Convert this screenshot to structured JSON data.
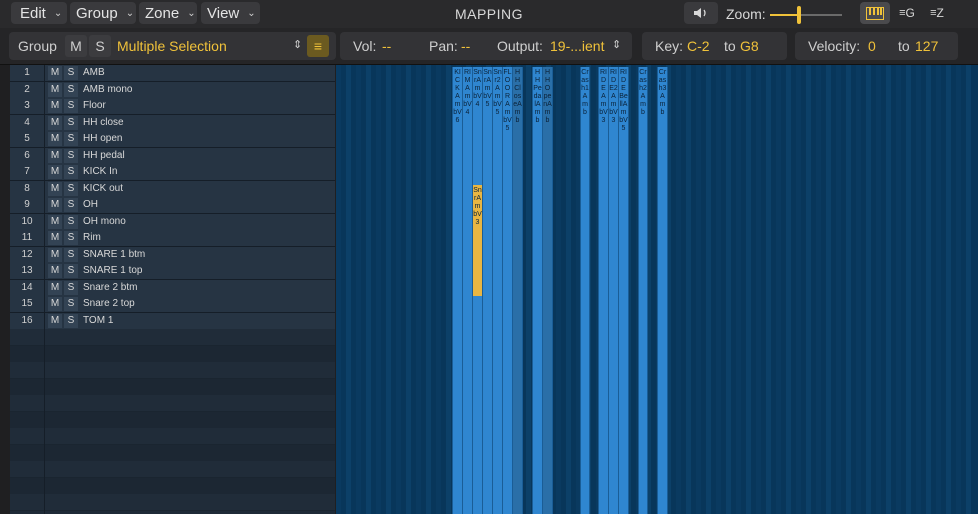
{
  "menus": {
    "edit": "Edit",
    "group": "Group",
    "zone": "Zone",
    "view": "View"
  },
  "title": "MAPPING",
  "zoom_label": "Zoom:",
  "zoom_level": 0.4,
  "view_buttons": {
    "keyboard": "keyboard-icon",
    "group_view": "G",
    "zone_view": "Z"
  },
  "group_bar": {
    "label": "Group",
    "mute": "M",
    "solo": "S",
    "selection": "Multiple Selection"
  },
  "params": {
    "vol_label": "Vol:",
    "vol_value": "--",
    "pan_label": "Pan:",
    "pan_value": "--",
    "output_label": "Output:",
    "output_value": "19-...ient",
    "key_label": "Key:",
    "key_low": "C-2",
    "key_to": "to",
    "key_high": "G8",
    "vel_label": "Velocity:",
    "vel_low": "0",
    "vel_to": "to",
    "vel_high": "127"
  },
  "groups": [
    {
      "num": "1",
      "m": "M",
      "s": "S",
      "name": "AMB"
    },
    {
      "num": "2",
      "m": "M",
      "s": "S",
      "name": "AMB mono"
    },
    {
      "num": "3",
      "m": "M",
      "s": "S",
      "name": "Floor"
    },
    {
      "num": "4",
      "m": "M",
      "s": "S",
      "name": "HH close"
    },
    {
      "num": "5",
      "m": "M",
      "s": "S",
      "name": "HH open"
    },
    {
      "num": "6",
      "m": "M",
      "s": "S",
      "name": "HH pedal"
    },
    {
      "num": "7",
      "m": "M",
      "s": "S",
      "name": "KICK In"
    },
    {
      "num": "8",
      "m": "M",
      "s": "S",
      "name": "KICK out"
    },
    {
      "num": "9",
      "m": "M",
      "s": "S",
      "name": "OH"
    },
    {
      "num": "10",
      "m": "M",
      "s": "S",
      "name": "OH mono"
    },
    {
      "num": "11",
      "m": "M",
      "s": "S",
      "name": "Rim"
    },
    {
      "num": "12",
      "m": "M",
      "s": "S",
      "name": "SNARE 1 btm"
    },
    {
      "num": "13",
      "m": "M",
      "s": "S",
      "name": "SNARE 1 top"
    },
    {
      "num": "14",
      "m": "M",
      "s": "S",
      "name": "Snare 2 btm"
    },
    {
      "num": "15",
      "m": "M",
      "s": "S",
      "name": "Snare 2 top"
    },
    {
      "num": "16",
      "m": "M",
      "s": "S",
      "name": "TOM 1"
    }
  ],
  "zones": [
    {
      "label": "KICKAmbV6",
      "state": "normal"
    },
    {
      "label": "RIMAmbV4",
      "state": "normal"
    },
    {
      "label": "SnrAmbV4",
      "state": "normal"
    },
    {
      "label": "SnrAmbV5",
      "state": "normal"
    },
    {
      "label": "Snr2AmbV5",
      "state": "normal"
    },
    {
      "label": "FLOORAmbV5",
      "state": "normal"
    },
    {
      "label": "HHCloseAmb",
      "state": "dim"
    },
    {
      "label": "HHPedalAmb",
      "state": "normal"
    },
    {
      "label": "HHOpenAmb",
      "state": "dim"
    },
    {
      "label": "Crash1Amb",
      "state": "normal"
    },
    {
      "label": "RIDEAmbV3",
      "state": "normal"
    },
    {
      "label": "RIDE2AmbV3",
      "state": "normal"
    },
    {
      "label": "RIDEBellAmbV5",
      "state": "normal"
    },
    {
      "label": "Crash2Amb",
      "state": "normal"
    },
    {
      "label": "Crash3Amb",
      "state": "normal"
    },
    {
      "label": "SnrAmbV3",
      "state": "highlight"
    }
  ]
}
